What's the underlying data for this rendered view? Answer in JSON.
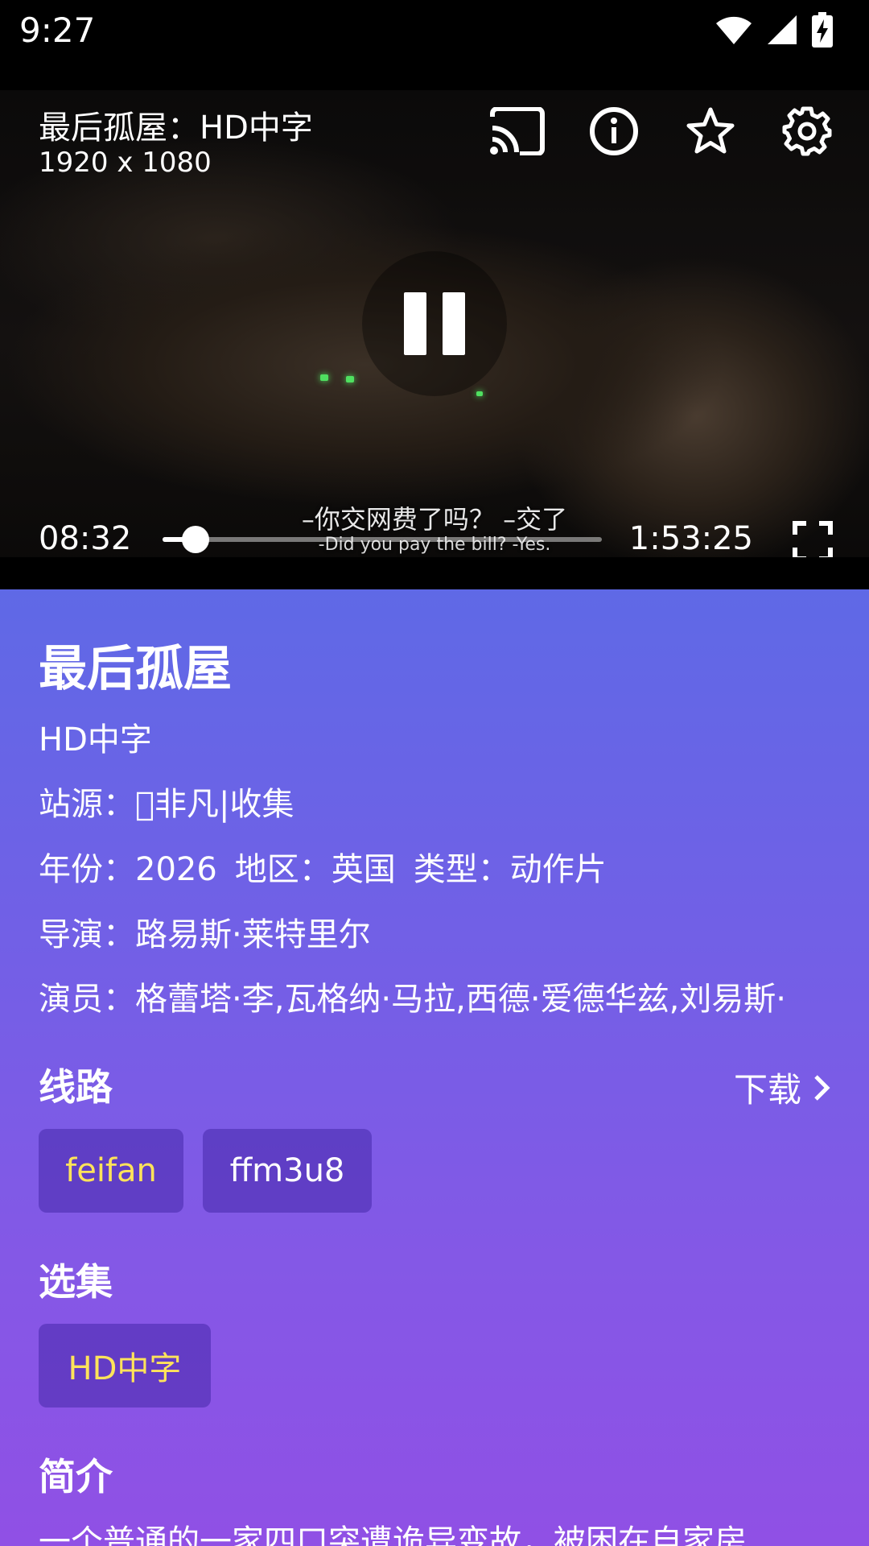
{
  "status_bar": {
    "time": "9:27"
  },
  "player": {
    "title": "最后孤屋：HD中字",
    "resolution": "1920 x 1080",
    "subtitle_cn": "–你交网费了吗？ –交了",
    "subtitle_en": "-Did you pay the bill? -Yes.",
    "current_time": "08:32",
    "total_time": "1:53:25",
    "progress": 0.075,
    "icons": [
      "cast-icon",
      "info-icon",
      "star-icon",
      "settings-icon",
      "pause-icon",
      "fullscreen-icon"
    ]
  },
  "details": {
    "title": "最后孤屋",
    "quality": "HD中字",
    "source": "站源：\u0000非凡|收集",
    "year_label": "年份：",
    "year": "2026",
    "region_label": "地区：",
    "region": "英国",
    "genre_label": "类型：",
    "genre": "动作片",
    "director": "导演：路易斯·莱特里尔",
    "cast": "演员：格蕾塔·李,瓦格纳·马拉,西德·爱德华兹,刘易斯·",
    "routes_title": "线路",
    "download_label": "下载",
    "routes": [
      "feifan",
      "ffm3u8"
    ],
    "episodes_title": "选集",
    "episodes": [
      "HD中字"
    ],
    "intro_title": "简介",
    "synopsis": "一个普通的一家四口突遭诡异变故，被困在自家房"
  },
  "colors": {
    "panel_top": "#5f69e6",
    "panel_bottom": "#9050e5",
    "chip_selected_text": "#ffe35a"
  }
}
